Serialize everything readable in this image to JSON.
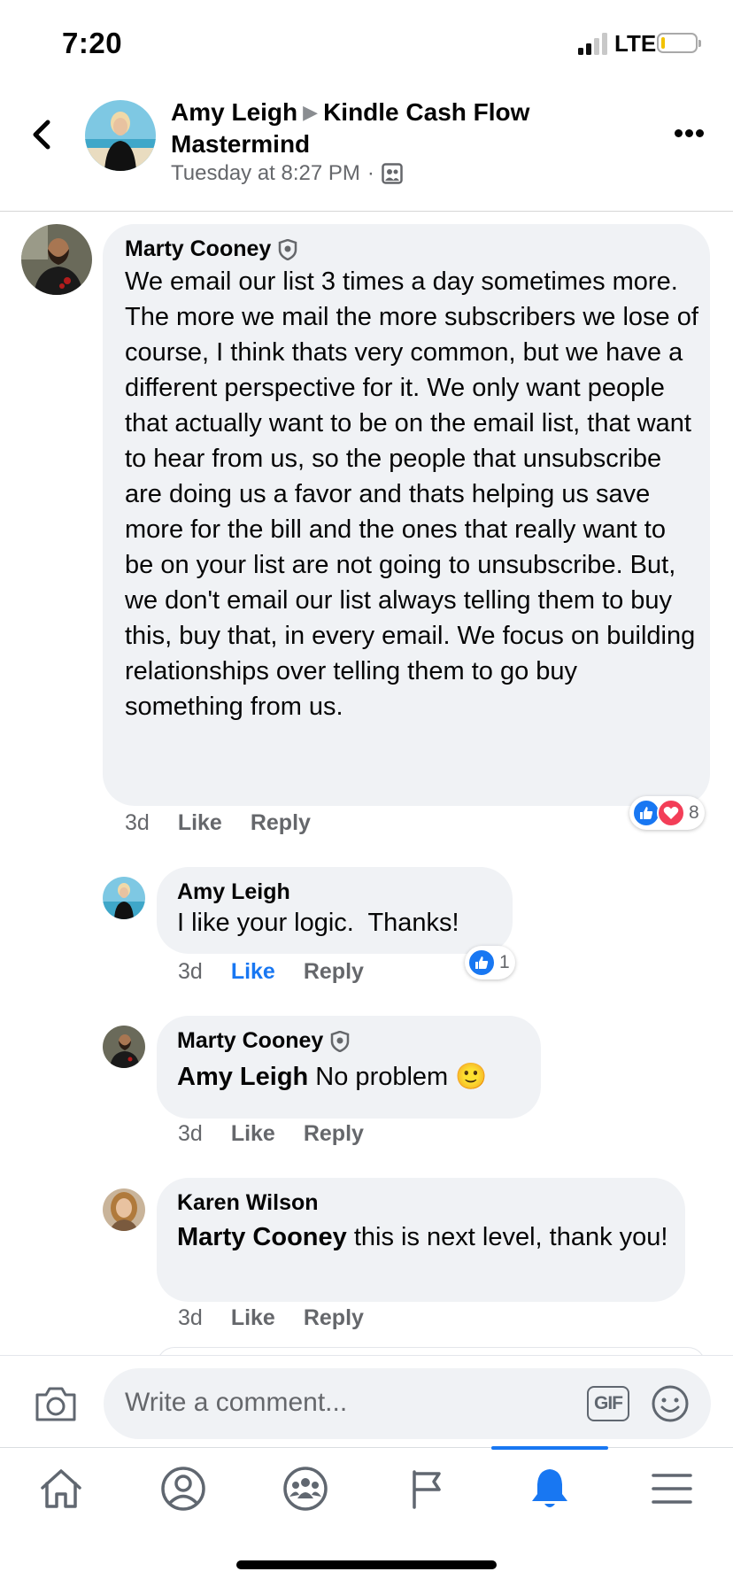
{
  "status_bar": {
    "time": "7:20",
    "network": "LTE"
  },
  "post_header": {
    "author": "Amy Leigh",
    "group": "Kindle Cash Flow Mastermind",
    "timestamp": "Tuesday at 8:27 PM",
    "separator": "·",
    "audience_icon": "group-members-icon"
  },
  "comments": [
    {
      "author": "Marty Cooney",
      "badge_icon": "shield-badge-icon",
      "text": "We email our list 3 times a day sometimes more. The more we mail the more subscribers we lose of course, I think thats very common, but we have a different perspective for it. We only want people that actually want to be on the email list, that want to hear from us, so the people that unsubscribe are doing us a favor and thats helping us save more for the bill and the ones that really want to be on your list are not going to unsubscribe. But, we don't email our list always telling them to buy this, buy that, in every email. We focus on building relationships over telling them to go buy something from us.",
      "age": "3d",
      "like": "Like",
      "reply": "Reply",
      "reactions": {
        "types": [
          "like",
          "love"
        ],
        "count": "8"
      }
    },
    {
      "author": "Amy Leigh",
      "text": "I like your logic.  Thanks!",
      "age": "3d",
      "like": "Like",
      "reply": "Reply",
      "liked": true,
      "reactions": {
        "types": [
          "like"
        ],
        "count": "1"
      }
    },
    {
      "author": "Marty Cooney",
      "badge_icon": "shield-badge-icon",
      "mention": "Amy Leigh",
      "text": " No problem 🙂",
      "age": "3d",
      "like": "Like",
      "reply": "Reply"
    },
    {
      "author": "Karen Wilson",
      "mention": "Marty Cooney",
      "text": " this is next level, thank you!",
      "age": "3d",
      "like": "Like",
      "reply": "Reply"
    }
  ],
  "composer": {
    "placeholder": "Write a comment...",
    "gif_label": "GIF"
  },
  "nav": {
    "items": [
      "home-icon",
      "profile-icon",
      "groups-icon",
      "pages-flag-icon",
      "notifications-bell-icon",
      "menu-icon"
    ],
    "active": "notifications-bell-icon"
  },
  "colors": {
    "accent": "#1877f2",
    "bubble": "#f0f2f5",
    "secondary_text": "#65676b",
    "love": "#f33e58"
  }
}
